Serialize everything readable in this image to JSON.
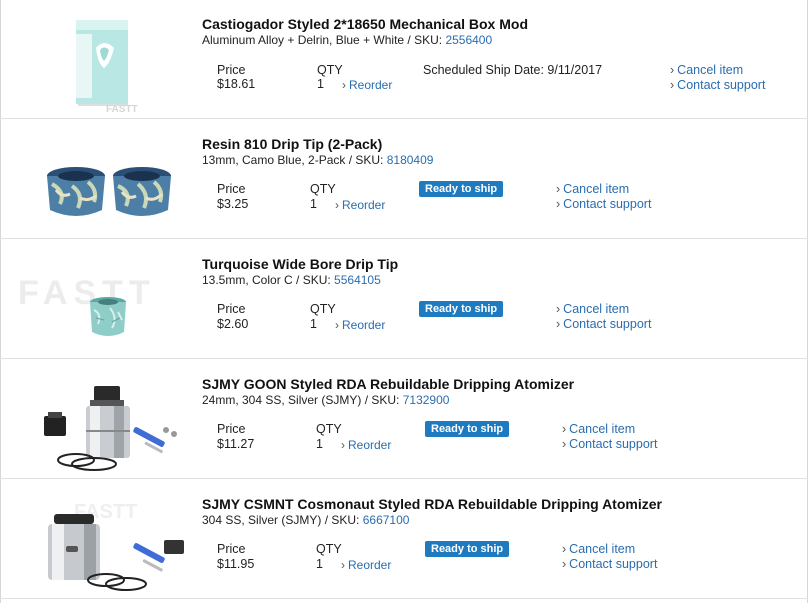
{
  "labels": {
    "price": "Price",
    "qty": "QTY",
    "reorder": "Reorder",
    "cancel": "Cancel item",
    "contact": "Contact support"
  },
  "orders": [
    {
      "title": "Castiogador Styled 2*18650 Mechanical Box Mod",
      "spec": "Aluminum Alloy + Delrin, Blue + White / SKU: ",
      "sku": "2556400",
      "price": "$18.61",
      "qty": "1",
      "ship_text": "Scheduled Ship Date: 9/11/2017",
      "status": "",
      "image_icon": "box-mod-image"
    },
    {
      "title": "Resin 810 Drip Tip (2-Pack)",
      "spec": "13mm, Camo Blue, 2-Pack / SKU: ",
      "sku": "8180409",
      "price": "$3.25",
      "qty": "1",
      "ship_text": "",
      "status": "Ready to ship",
      "image_icon": "drip-tip-pair-image"
    },
    {
      "title": "Turquoise Wide Bore Drip Tip",
      "spec": "13.5mm, Color C / SKU: ",
      "sku": "5564105",
      "price": "$2.60",
      "qty": "1",
      "ship_text": "",
      "status": "Ready to ship",
      "image_icon": "turquoise-drip-tip-image"
    },
    {
      "title": "SJMY GOON Styled RDA Rebuildable Dripping Atomizer",
      "spec": "24mm, 304 SS, Silver (SJMY) / SKU: ",
      "sku": "7132900",
      "price": "$11.27",
      "qty": "1",
      "ship_text": "",
      "status": "Ready to ship",
      "image_icon": "rda-atomizer-image"
    },
    {
      "title": "SJMY CSMNT Cosmonaut Styled RDA Rebuildable Dripping Atomizer",
      "spec": "304 SS, Silver (SJMY) / SKU: ",
      "sku": "6667100",
      "price": "$11.95",
      "qty": "1",
      "ship_text": "",
      "status": "Ready to ship",
      "image_icon": "rda-atomizer-image"
    }
  ]
}
